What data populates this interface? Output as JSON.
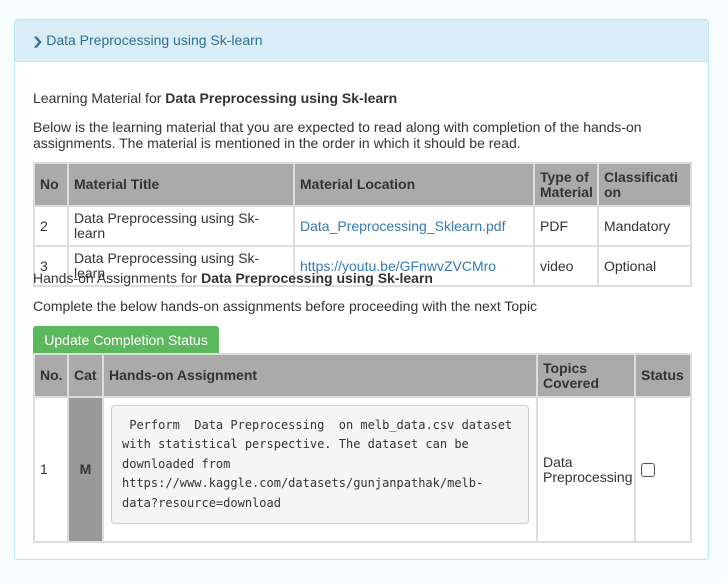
{
  "panel": {
    "title": "Data Preprocessing using Sk-learn",
    "chevron_icon": "chevron-down-icon"
  },
  "learning": {
    "prefix": "Learning Material for ",
    "topic": "Data Preprocessing using Sk-learn",
    "description": "Below is the learning material that you are expected to read along with completion of the hands-on assignments. The material is mentioned in the order in which it should be read.",
    "headers": [
      "No",
      "Material Title",
      "Material Location",
      "Type of Material",
      "Classification"
    ],
    "rows": [
      {
        "no": "2",
        "title": "Data Preprocessing using Sk-learn",
        "location": "Data_Preprocessing_Sklearn.pdf",
        "type": "PDF",
        "classification": "Mandatory"
      },
      {
        "no": "3",
        "title": "Data Preprocessing using Sk-learn",
        "location": "https://youtu.be/GFnwvZVCMro",
        "type": "video",
        "classification": "Optional"
      }
    ]
  },
  "handson": {
    "prefix": "Hands-on Assignments for ",
    "topic": "Data Preprocessing using Sk-learn",
    "description": "Complete the below hands-on assignments before proceeding with the next Topic",
    "button": "Update Completion Status",
    "headers": [
      "No.",
      "Cat",
      "Hands-on Assignment",
      "Topics Covered",
      "Status"
    ],
    "rows": [
      {
        "no": "1",
        "cat": "M",
        "assignment": " Perform  Data Preprocessing  on melb_data.csv dataset with statistical perspective. The dataset can be downloaded from https://www.kaggle.com/datasets/gunjanpathak/melb-data?resource=download",
        "topics": "Data Preprocessing",
        "status_checked": false
      }
    ]
  }
}
